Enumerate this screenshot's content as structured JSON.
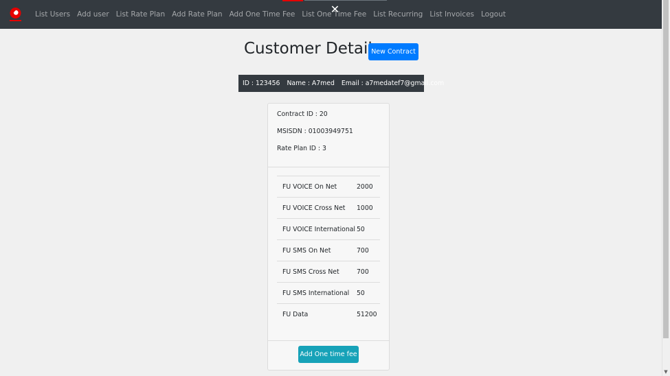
{
  "navbar": {
    "links": [
      {
        "label": "List Users"
      },
      {
        "label": "Add user"
      },
      {
        "label": "List Rate Plan"
      },
      {
        "label": "Add Rate Plan"
      },
      {
        "label": "Add One Time Fee"
      },
      {
        "label": "List One Time Fee"
      },
      {
        "label": "List Recurring"
      },
      {
        "label": "List Invoices"
      },
      {
        "label": "Logout"
      }
    ],
    "close_symbol": "✕",
    "brand_color": "#e60000",
    "background": "#343a40"
  },
  "header": {
    "title": "Customer Details",
    "new_contract_label": "New Contract"
  },
  "customer": {
    "id": "ID : 123456",
    "name": "Name : A7med",
    "email": "Email : a7medatef7@gmail.com"
  },
  "contract": {
    "contract_id": "Contract ID : 20",
    "msisdn": "MSISDN : 01003949751",
    "rate_plan_id": "Rate Plan ID : 3",
    "fu_items": [
      {
        "name": "FU VOICE On Net",
        "value": "2000"
      },
      {
        "name": "FU VOICE Cross Net",
        "value": "1000"
      },
      {
        "name": "FU VOICE International",
        "value": "50"
      },
      {
        "name": "FU SMS On Net",
        "value": "700"
      },
      {
        "name": "FU SMS Cross Net",
        "value": "700"
      },
      {
        "name": "FU SMS International",
        "value": "50"
      },
      {
        "name": "FU Data",
        "value": "51200"
      }
    ],
    "add_fee_label": "Add One time fee"
  },
  "colors": {
    "primary": "#007bff",
    "info": "#17a2b8",
    "dark": "#343a40"
  },
  "icons": {
    "brand": "vodafone-logo-icon",
    "close": "close-icon"
  }
}
